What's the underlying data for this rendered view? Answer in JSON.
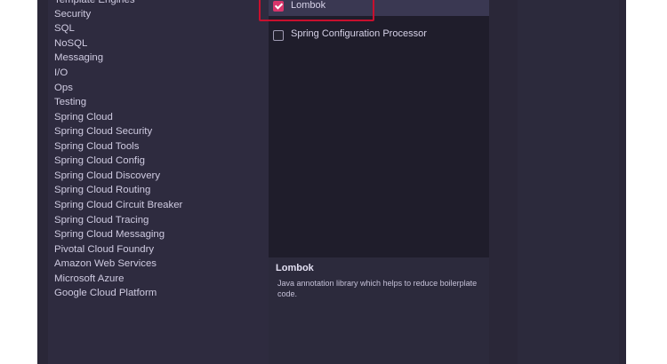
{
  "categories": {
    "items": [
      {
        "label": "Template Engines"
      },
      {
        "label": "Security"
      },
      {
        "label": "SQL"
      },
      {
        "label": "NoSQL"
      },
      {
        "label": "Messaging"
      },
      {
        "label": "I/O"
      },
      {
        "label": "Ops"
      },
      {
        "label": "Testing"
      },
      {
        "label": "Spring Cloud"
      },
      {
        "label": "Spring Cloud Security"
      },
      {
        "label": "Spring Cloud Tools"
      },
      {
        "label": "Spring Cloud Config"
      },
      {
        "label": "Spring Cloud Discovery"
      },
      {
        "label": "Spring Cloud Routing"
      },
      {
        "label": "Spring Cloud Circuit Breaker"
      },
      {
        "label": "Spring Cloud Tracing"
      },
      {
        "label": "Spring Cloud Messaging"
      },
      {
        "label": "Pivotal Cloud Foundry"
      },
      {
        "label": "Amazon Web Services"
      },
      {
        "label": "Microsoft Azure"
      },
      {
        "label": "Google Cloud Platform"
      }
    ]
  },
  "dependencies": {
    "items": [
      {
        "label": "Lombok",
        "checked": true,
        "selected": true
      },
      {
        "label": "Spring Configuration Processor",
        "checked": false,
        "selected": false
      }
    ]
  },
  "description": {
    "title": "Lombok",
    "text": "Java annotation library which helps to reduce boilerplate code."
  },
  "colors": {
    "accent": "#d8356b",
    "highlight_border": "#c8102e"
  }
}
